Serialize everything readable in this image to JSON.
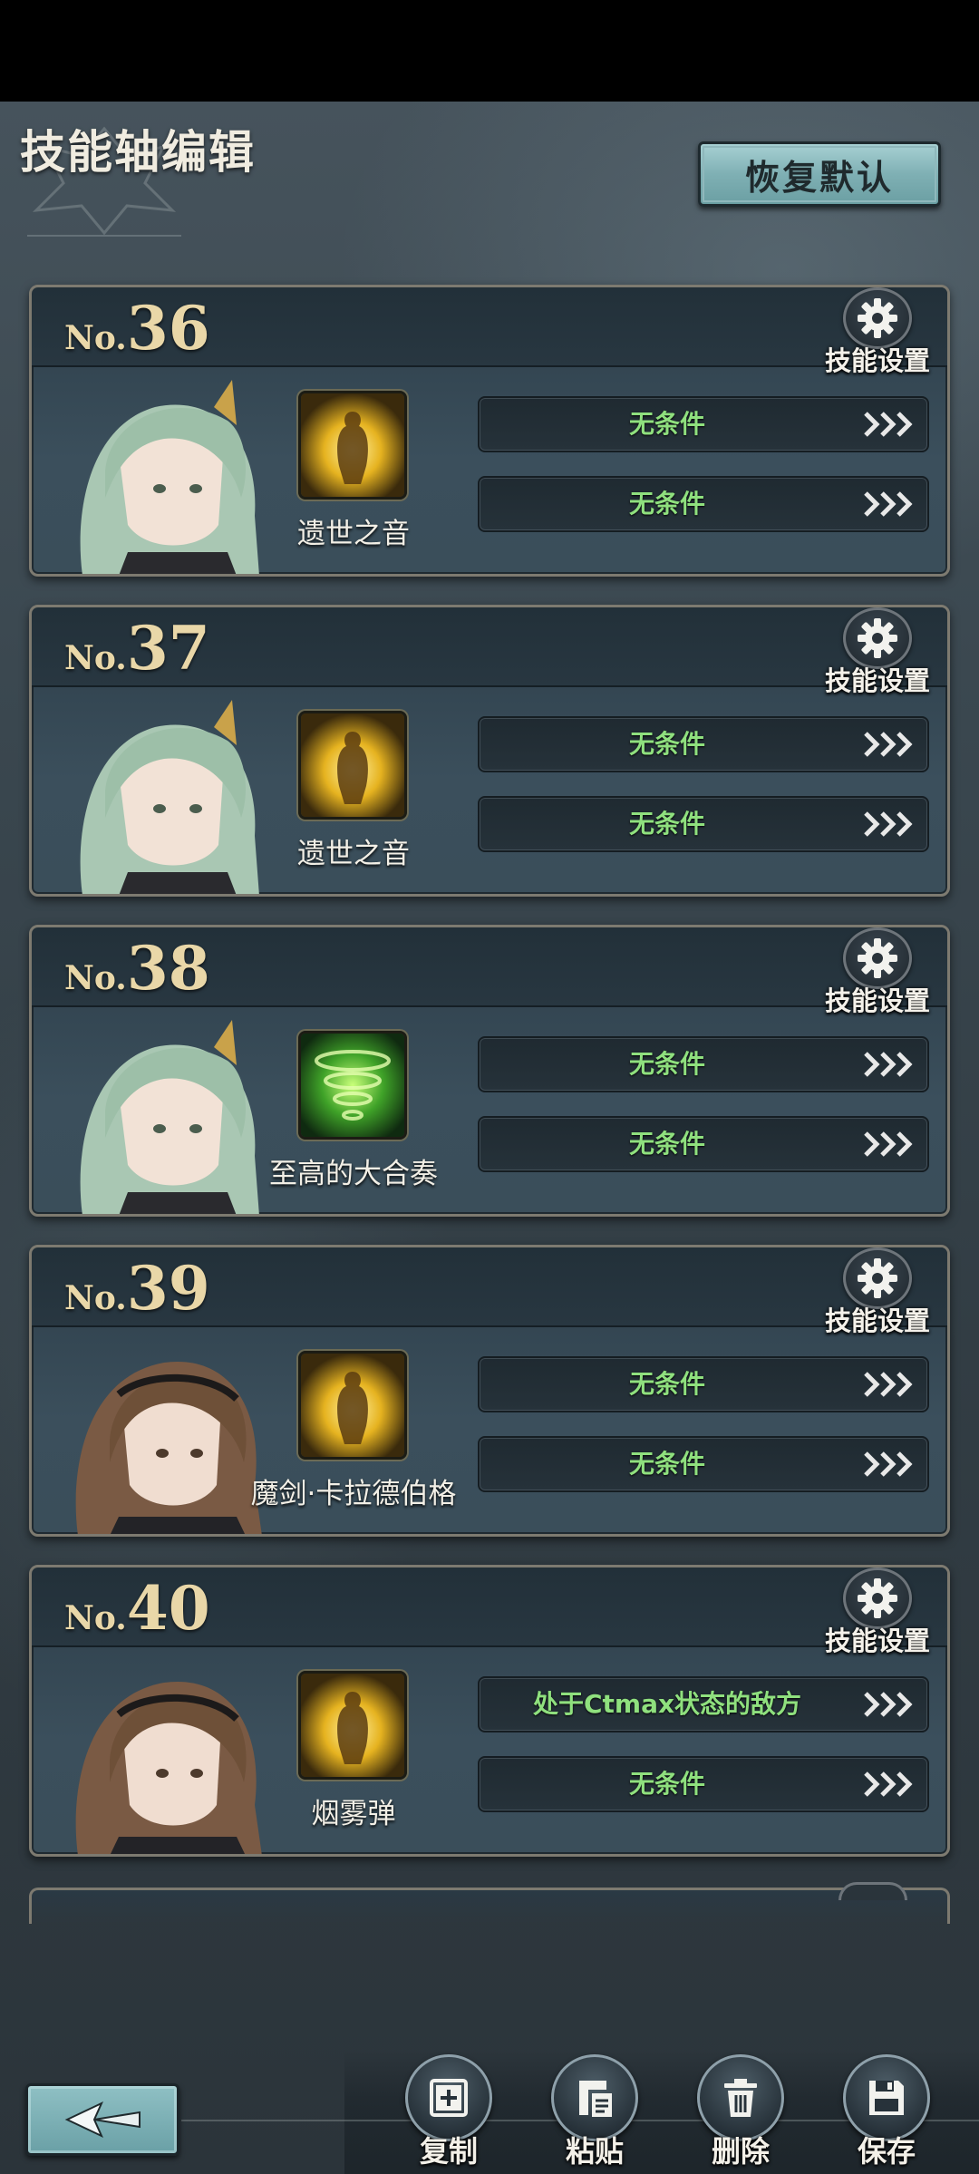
{
  "header": {
    "title": "技能轴编辑",
    "reset_label": "恢复默认"
  },
  "settings_label": "技能设置",
  "no_prefix": "No.",
  "cards": [
    {
      "number": "36",
      "skill": "遗世之音",
      "skill_icon": "golden-figure-icon",
      "portrait": "green-hair-character",
      "conditions": [
        "无条件",
        "无条件"
      ]
    },
    {
      "number": "37",
      "skill": "遗世之音",
      "skill_icon": "golden-figure-icon",
      "portrait": "green-hair-character",
      "conditions": [
        "无条件",
        "无条件"
      ]
    },
    {
      "number": "38",
      "skill": "至高的大合奏",
      "skill_icon": "green-tornado-icon",
      "portrait": "green-hair-character",
      "conditions": [
        "无条件",
        "无条件"
      ]
    },
    {
      "number": "39",
      "skill": "魔剑·卡拉德伯格",
      "skill_icon": "golden-figure-icon",
      "portrait": "brown-hair-character",
      "conditions": [
        "无条件",
        "无条件"
      ]
    },
    {
      "number": "40",
      "skill": "烟雾弹",
      "skill_icon": "golden-figure-icon",
      "portrait": "brown-hair-character",
      "conditions": [
        "处于Ctmax状态的敌方",
        "无条件"
      ]
    }
  ],
  "toolbar": {
    "copy_label": "复制",
    "paste_label": "粘贴",
    "delete_label": "删除",
    "save_label": "保存"
  },
  "colors": {
    "condition_text": "#8fe07e",
    "number_gold": "#e9d7a8",
    "button_teal": "#7fb0b4"
  }
}
